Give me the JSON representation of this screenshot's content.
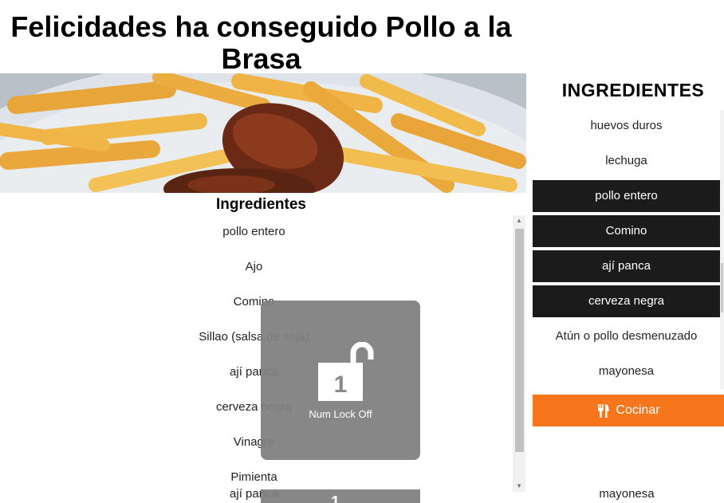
{
  "page": {
    "title": "Felicidades ha conseguido Pollo a la Brasa"
  },
  "left": {
    "heading": "Ingredientes",
    "items": [
      "pollo entero",
      "Ajo",
      "Comino",
      "Sillao (salsa de soja)",
      "ají panca",
      "cerveza negra",
      "Vinagre",
      "Pimienta"
    ],
    "overflow_item": "ají panca"
  },
  "toast": {
    "label": "Num Lock Off",
    "digit": "1"
  },
  "right": {
    "heading": "INGREDIENTES",
    "items": [
      {
        "label": "huevos duros",
        "selected": false
      },
      {
        "label": "lechuga",
        "selected": false
      },
      {
        "label": "pollo entero",
        "selected": true
      },
      {
        "label": "Comino",
        "selected": true
      },
      {
        "label": "ají panca",
        "selected": true
      },
      {
        "label": "cerveza negra",
        "selected": true
      },
      {
        "label": "Atún o pollo desmenuzado",
        "selected": false
      },
      {
        "label": "mayonesa",
        "selected": false
      }
    ],
    "cook_button": "Cocinar",
    "cook_icon": "utensils-icon",
    "bottom_item": "mayonesa"
  },
  "colors": {
    "accent": "#f7761b",
    "selected_bg": "#1b1b1b"
  }
}
